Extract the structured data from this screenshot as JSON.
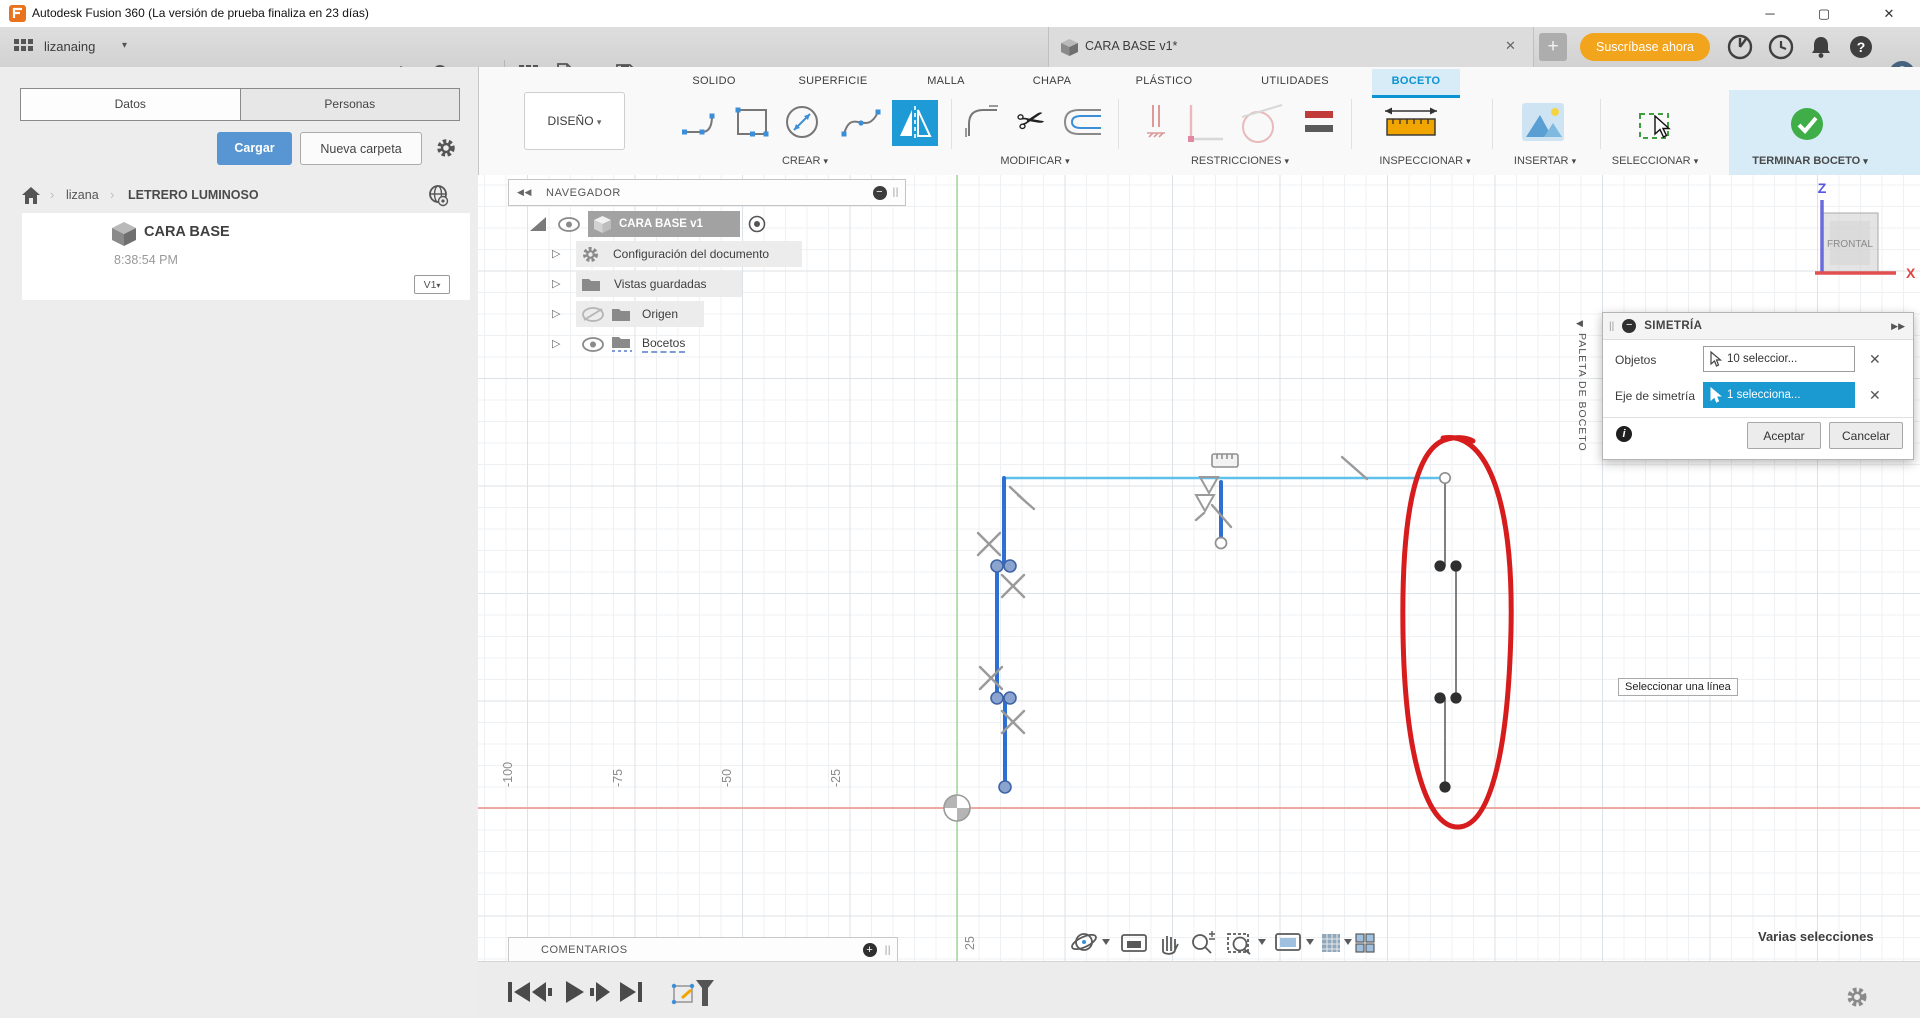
{
  "title_bar": {
    "app_title": "Autodesk Fusion 360 (La versión de prueba finaliza en 23 días)"
  },
  "app_bar": {
    "username": "lizanaing",
    "document_tab": {
      "title": "CARA BASE v1*"
    },
    "subscribe_button": "Suscríbase ahora"
  },
  "ribbon": {
    "design_menu": "DISEÑO",
    "tabs": [
      "SOLIDO",
      "SUPERFICIE",
      "MALLA",
      "CHAPA",
      "PLÁSTICO",
      "UTILIDADES",
      "BOCETO"
    ],
    "groups": {
      "create": "CREAR",
      "modify": "MODIFICAR",
      "constraints": "RESTRICCIONES",
      "inspect": "INSPECCIONAR",
      "insert": "INSERTAR",
      "select": "SELECCIONAR",
      "finish": "TERMINAR BOCETO"
    }
  },
  "data_panel": {
    "tabs": {
      "data": "Datos",
      "people": "Personas"
    },
    "upload_button": "Cargar",
    "new_folder_button": "Nueva carpeta",
    "breadcrumb": {
      "home_user": "lizana",
      "project": "LETRERO LUMINOSO"
    },
    "file_card": {
      "name": "CARA BASE",
      "time": "8:38:54 PM",
      "version": "V1"
    }
  },
  "navigator": {
    "title": "NAVEGADOR",
    "root_item": "CARA BASE v1",
    "items": [
      "Configuración del documento",
      "Vistas guardadas",
      "Origen",
      "Bocetos"
    ]
  },
  "sketch_palette": {
    "label": "PALETA DE BOCETO"
  },
  "symmetry_dialog": {
    "title": "SIMETRÍA",
    "objects_label": "Objetos",
    "objects_value": "10 seleccior...",
    "axis_label": "Eje de simetría",
    "axis_value": "1 selecciona...",
    "ok_button": "Aceptar",
    "cancel_button": "Cancelar"
  },
  "canvas": {
    "axis_labels": [
      "-100",
      "-75",
      "-50",
      "-25"
    ],
    "origin_below_label": "25",
    "tooltip": "Seleccionar una línea",
    "status_text": "Varias selecciones",
    "viewcube": {
      "face": "FRONTAL",
      "z_axis": "Z",
      "x_axis": "X"
    }
  },
  "comments_bar": {
    "label": "COMENTARIOS"
  },
  "glyphs": {
    "chevron_down": "▾",
    "breadcrumb_sep": "›",
    "collapse_left": "◀◀",
    "collapse_single": "◀",
    "expand_right": "▶▶",
    "pin": "||",
    "close": "✕",
    "plus": "+",
    "minus": "−",
    "info": "i",
    "question": "?",
    "tree_expand": "▷",
    "win_min": "─",
    "win_max": "▢",
    "win_close": "✕"
  },
  "colors": {
    "selection_blue": "#2e6fd3",
    "construction_cyan": "#5fc0ea",
    "annotation_red": "#d61c1c",
    "accent_blue": "#0a94d1",
    "axis_red": "#eb9f97",
    "axis_green": "#abd7a2"
  }
}
